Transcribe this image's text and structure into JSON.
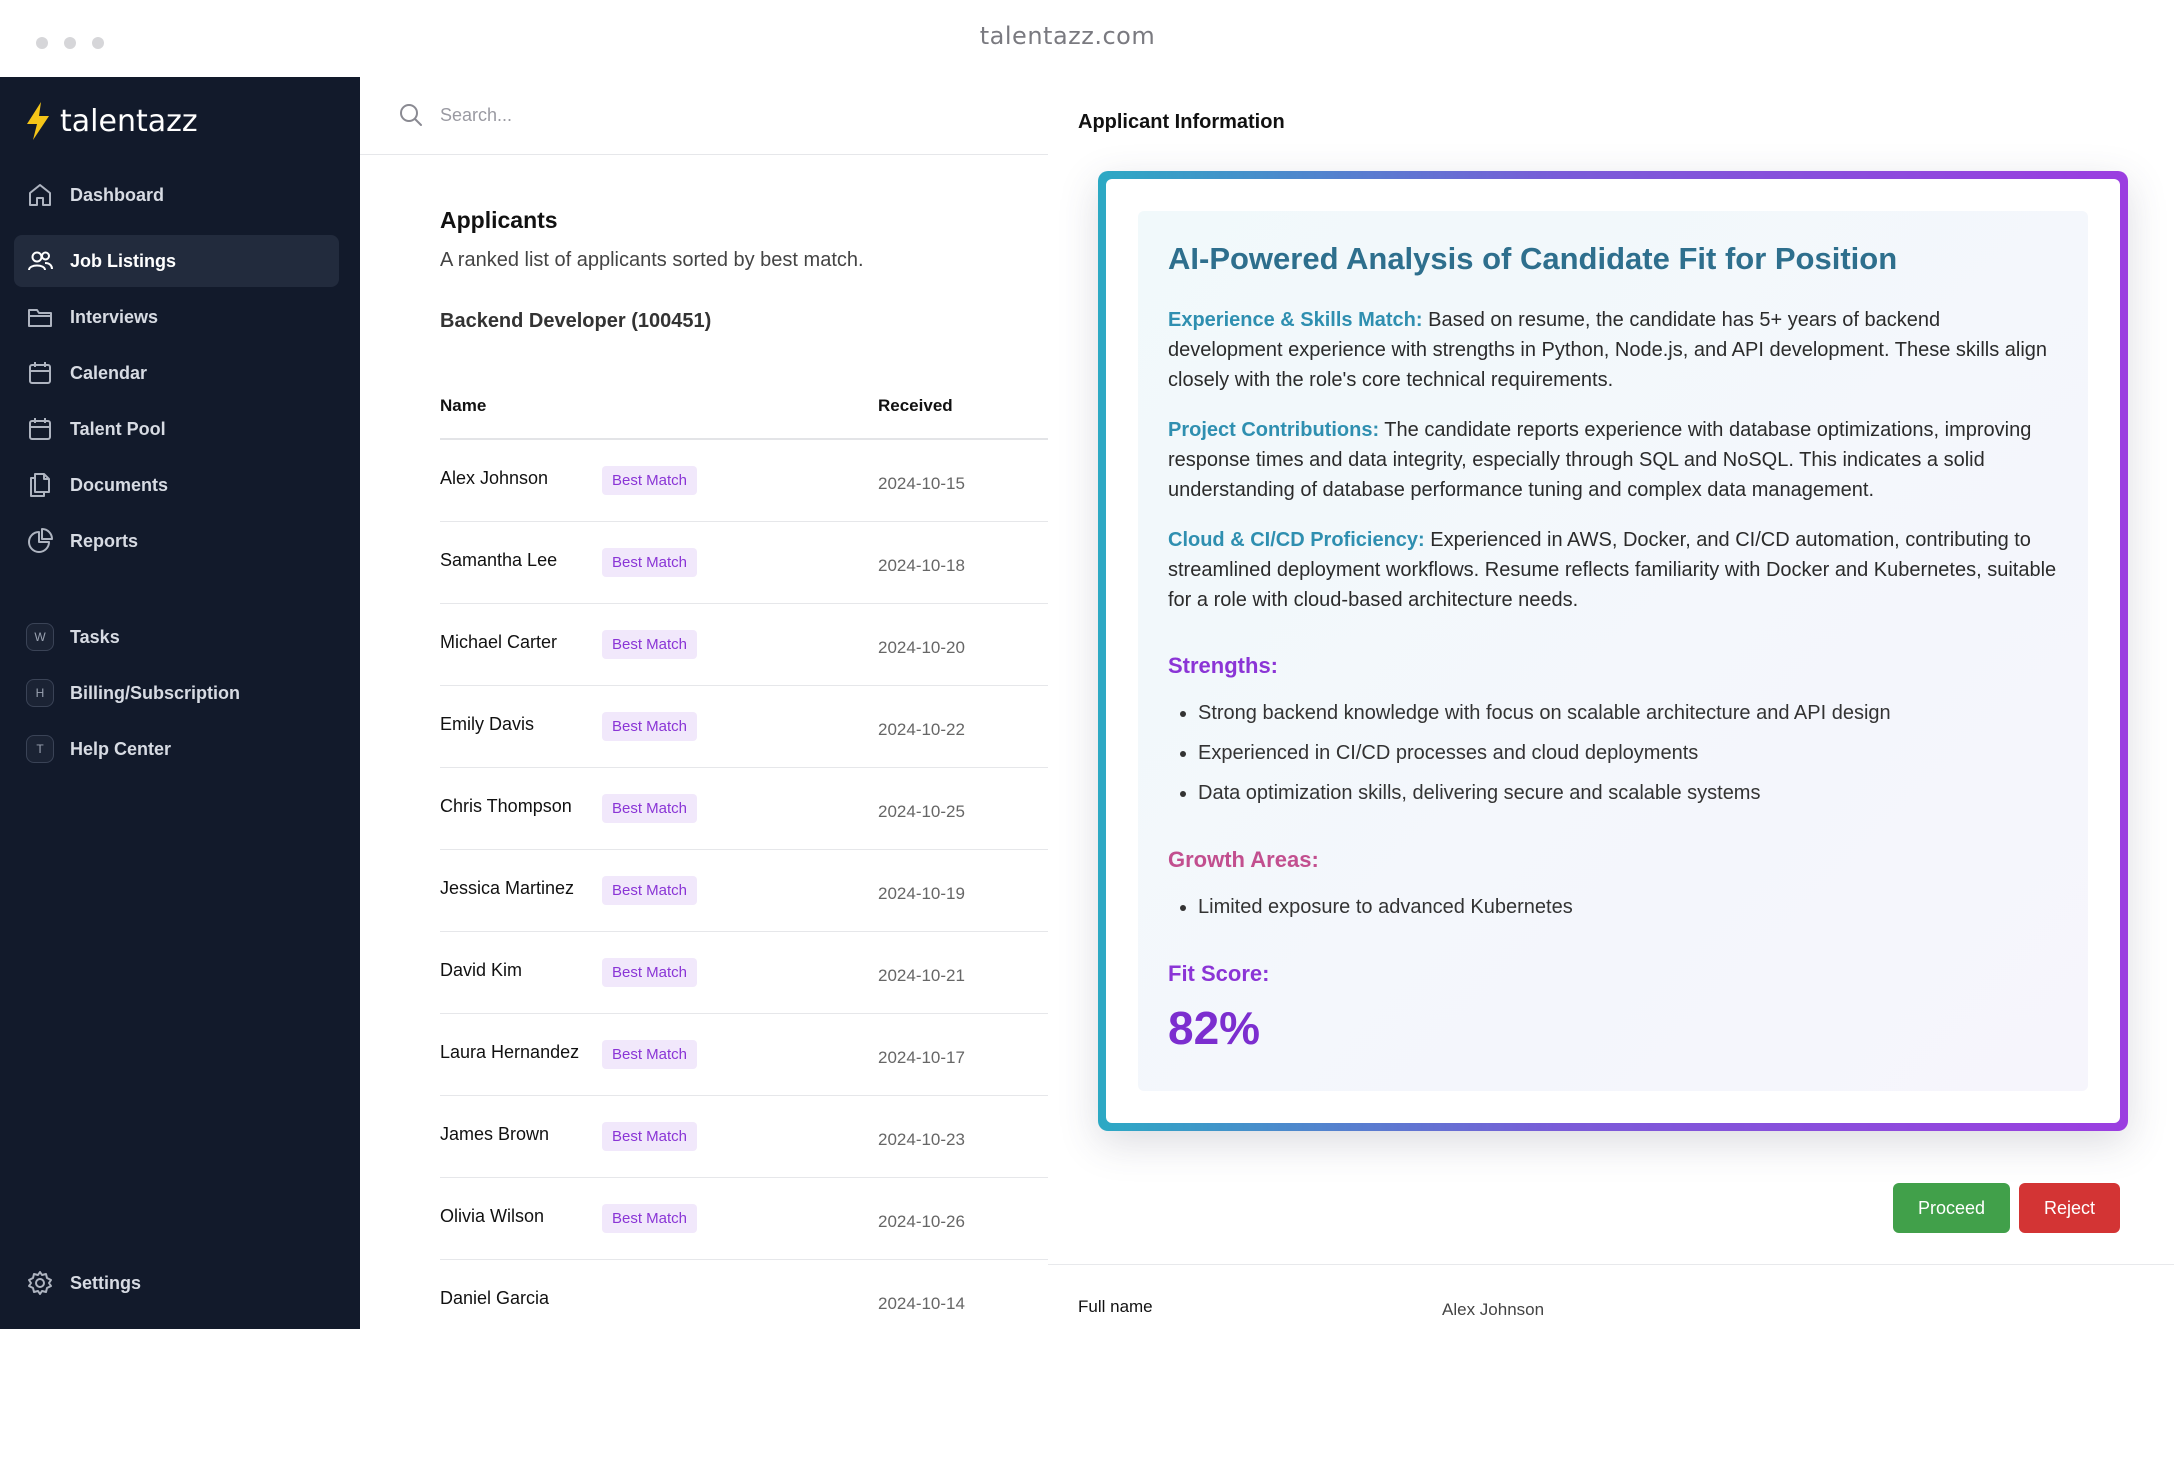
{
  "browser": {
    "url": "talentazz.com"
  },
  "brand": {
    "name": "talentazz",
    "accent": "#f5c518"
  },
  "sidebar": {
    "items": [
      {
        "label": "Dashboard",
        "icon": "home-icon"
      },
      {
        "label": "Job Listings",
        "icon": "users-icon",
        "active": true
      },
      {
        "label": "Interviews",
        "icon": "folder-icon"
      },
      {
        "label": "Calendar",
        "icon": "calendar-icon"
      },
      {
        "label": "Talent Pool",
        "icon": "calendar-icon"
      },
      {
        "label": "Documents",
        "icon": "documents-icon"
      },
      {
        "label": "Reports",
        "icon": "pie-chart-icon"
      }
    ],
    "secondary": [
      {
        "label": "Tasks",
        "badge": "W"
      },
      {
        "label": "Billing/Subscription",
        "badge": "H"
      },
      {
        "label": "Help Center",
        "badge": "T"
      }
    ],
    "settings": {
      "label": "Settings",
      "icon": "gear-icon"
    }
  },
  "search": {
    "placeholder": "Search..."
  },
  "applicants": {
    "title": "Applicants",
    "subtitle": "A ranked list of applicants sorted by best match.",
    "job": "Backend Developer (100451)",
    "columns": {
      "name": "Name",
      "received": "Received"
    },
    "rows": [
      {
        "name": "Alex Johnson",
        "tag": "Best Match",
        "received": "2024-10-15"
      },
      {
        "name": "Samantha Lee",
        "tag": "Best Match",
        "received": "2024-10-18"
      },
      {
        "name": "Michael Carter",
        "tag": "Best Match",
        "received": "2024-10-20"
      },
      {
        "name": "Emily Davis",
        "tag": "Best Match",
        "received": "2024-10-22"
      },
      {
        "name": "Chris Thompson",
        "tag": "Best Match",
        "received": "2024-10-25"
      },
      {
        "name": "Jessica Martinez",
        "tag": "Best Match",
        "received": "2024-10-19"
      },
      {
        "name": "David Kim",
        "tag": "Best Match",
        "received": "2024-10-21"
      },
      {
        "name": "Laura Hernandez",
        "tag": "Best Match",
        "received": "2024-10-17"
      },
      {
        "name": "James Brown",
        "tag": "Best Match",
        "received": "2024-10-23"
      },
      {
        "name": "Olivia Wilson",
        "tag": "Best Match",
        "received": "2024-10-26"
      },
      {
        "name": "Daniel Garcia",
        "tag": "",
        "received": "2024-10-14"
      }
    ]
  },
  "detail": {
    "title": "Applicant Information",
    "analysis": {
      "title": "AI-Powered Analysis of Candidate Fit for Position",
      "paragraphs": [
        {
          "key": "Experience & Skills Match:",
          "text": " Based on resume, the candidate has 5+ years of backend development experience with strengths in Python, Node.js, and API development. These skills align closely with the role's core technical requirements."
        },
        {
          "key": "Project Contributions:",
          "text": " The candidate reports experience with database optimizations, improving response times and data integrity, especially through SQL and NoSQL. This indicates a solid understanding of database performance tuning and complex data management."
        },
        {
          "key": "Cloud & CI/CD Proficiency:",
          "text": " Experienced in AWS, Docker, and CI/CD automation, contributing to streamlined deployment workflows. Resume reflects familiarity with Docker and Kubernetes, suitable for a role with cloud-based architecture needs."
        }
      ],
      "strengths_heading": "Strengths:",
      "strengths": [
        "Strong backend knowledge with focus on scalable architecture and API design",
        "Experienced in CI/CD processes and cloud deployments",
        "Data optimization skills, delivering secure and scalable systems"
      ],
      "growth_heading": "Growth Areas:",
      "growth": [
        "Limited exposure to advanced Kubernetes"
      ],
      "fit_heading": "Fit Score:",
      "fit_score": "82%"
    },
    "actions": {
      "proceed": "Proceed",
      "reject": "Reject"
    },
    "field": {
      "label": "Full name",
      "value": "Alex Johnson"
    }
  }
}
